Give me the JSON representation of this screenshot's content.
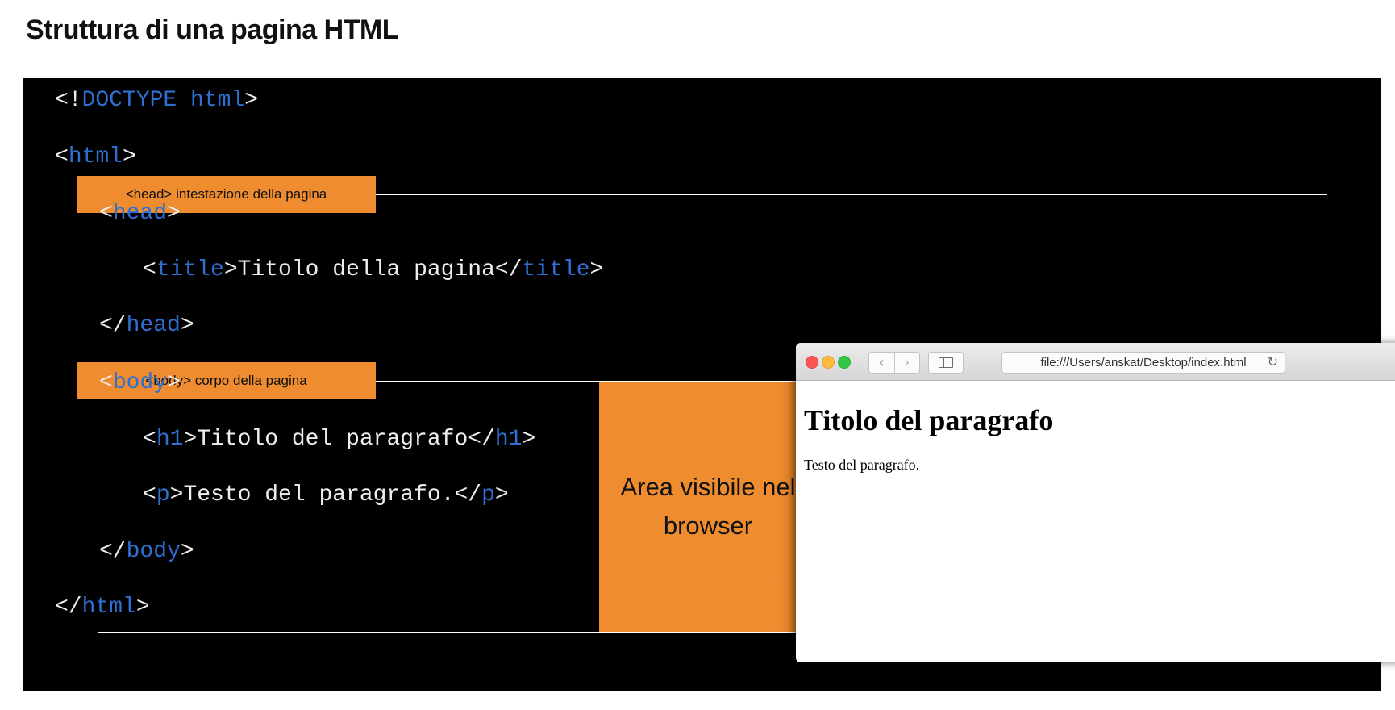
{
  "page": {
    "title": "Struttura di una pagina HTML"
  },
  "code": {
    "doctype": {
      "open": "<!",
      "keyword": "DOCTYPE html",
      "close": ">"
    },
    "html_open": {
      "lt": "<",
      "tag": "html",
      "gt": ">"
    },
    "head_open": {
      "lt": "<",
      "tag": "head",
      "gt": ">"
    },
    "title_line": {
      "lt": "<",
      "tag_open": "title",
      "gt": ">",
      "text": "Titolo della pagina",
      "lt_close": "</",
      "tag_close": "title",
      "gt_close": ">"
    },
    "head_close": {
      "lt": "</",
      "tag": "head",
      "gt": ">"
    },
    "body_open": {
      "lt": "<",
      "tag": "body",
      "gt": ">"
    },
    "h1_line": {
      "lt": "<",
      "tag_open": "h1",
      "gt": ">",
      "text": "Titolo del paragrafo",
      "lt_close": "</",
      "tag_close": "h1",
      "gt_close": ">"
    },
    "p_line": {
      "lt": "<",
      "tag_open": "p",
      "gt": ">",
      "text": "Testo del paragrafo.",
      "lt_close": "</",
      "tag_close": "p",
      "gt_close": ">"
    },
    "body_close": {
      "lt": "</",
      "tag": "body",
      "gt": ">"
    },
    "html_close": {
      "lt": "</",
      "tag": "html",
      "gt": ">"
    }
  },
  "labels": {
    "head": "<head> intestazione della pagina",
    "body": "<body> corpo della pagina",
    "visible_area": "Area visibile nel browser"
  },
  "browser": {
    "url": "file:///Users/anskat/Desktop/index.html",
    "content": {
      "heading": "Titolo del paragrafo",
      "paragraph": "Testo del paragrafo."
    }
  },
  "colors": {
    "accent_orange": "#ee8c2f",
    "code_background": "#000000",
    "code_tag": "#2f6fd1",
    "code_text": "#eeeeee"
  }
}
